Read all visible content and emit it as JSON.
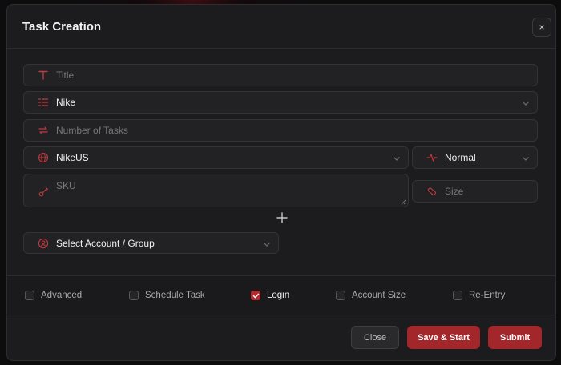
{
  "modal": {
    "title": "Task Creation",
    "close_glyph": "×"
  },
  "form": {
    "title_placeholder": "Title",
    "store_value": "Nike",
    "num_tasks_placeholder": "Number of Tasks",
    "region_value": "NikeUS",
    "mode_value": "Normal",
    "sku_placeholder": "SKU",
    "size_placeholder": "Size",
    "account_label": "Select Account / Group"
  },
  "options": {
    "advanced": "Advanced",
    "schedule": "Schedule Task",
    "login": "Login",
    "account_size": "Account Size",
    "reentry": "Re-Entry"
  },
  "checked": {
    "login": true
  },
  "footer": {
    "close": "Close",
    "save_start": "Save & Start",
    "submit": "Submit"
  },
  "colors": {
    "accent": "#a3262b",
    "icon_red": "#c0393e",
    "panel": "#1c1c1e"
  },
  "icons": {
    "title": "text-t-icon",
    "store": "list-icon",
    "tasks": "repeat-icon",
    "region": "globe-icon",
    "mode": "activity-icon",
    "sku": "key-icon",
    "size": "tag-icon",
    "account": "user-circle-icon"
  }
}
